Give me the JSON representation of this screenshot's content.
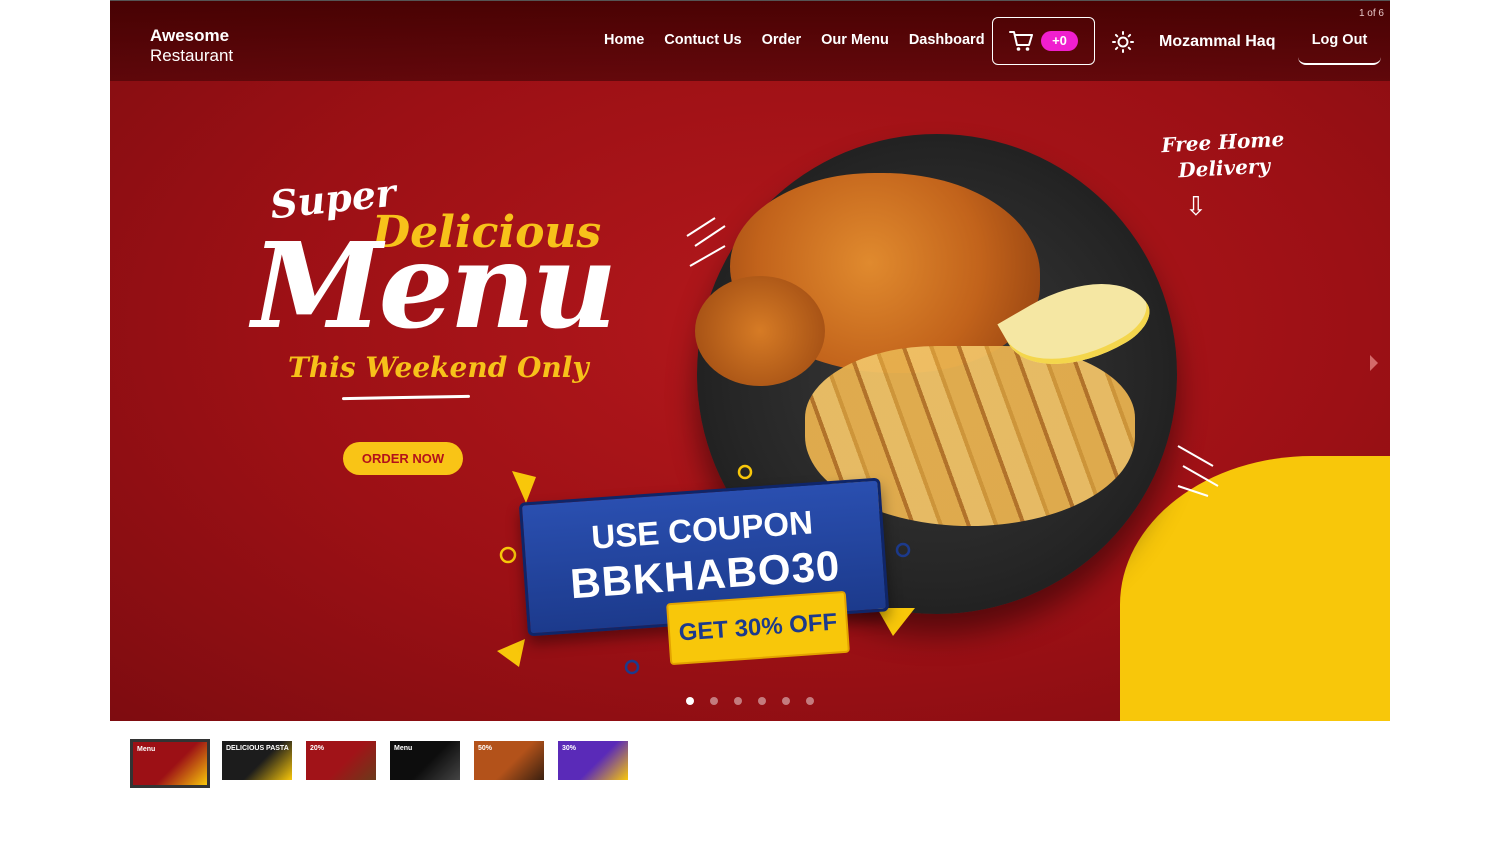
{
  "window": {
    "slide_counter": "1 of 6"
  },
  "navbar": {
    "brand_line1": "Awesome",
    "brand_line2": "Restaurant",
    "links": [
      "Home",
      "Contuct Us",
      "Order",
      "Our Menu",
      "Dashboard"
    ],
    "cart_badge": "+0",
    "user_name": "Mozammal Haq",
    "logout_label": "Log Out"
  },
  "hero": {
    "super": "Super",
    "delicious": "Delicious",
    "menu": "Menu",
    "weekend": "This Weekend Only",
    "cta_label": "ORDER NOW",
    "free_delivery_line1": "Free Home",
    "free_delivery_line2": "Delivery",
    "coupon_line1": "USE COUPON",
    "coupon_code": "BBKHABO30",
    "discount": "GET 30% OFF"
  },
  "carousel": {
    "slide_count": 6,
    "active_index": 0
  },
  "thumbnails": [
    {
      "caption": "Menu",
      "colors": [
        "#9c1015",
        "#f8c70a"
      ]
    },
    {
      "caption": "DELICIOUS PASTA",
      "colors": [
        "#1c1c1c",
        "#f8c70a"
      ]
    },
    {
      "caption": "20%",
      "colors": [
        "#a11318",
        "#6b3a1a"
      ]
    },
    {
      "caption": "Menu",
      "colors": [
        "#0d0d0d",
        "#444444"
      ]
    },
    {
      "caption": "50%",
      "colors": [
        "#b3521a",
        "#3a2010"
      ]
    },
    {
      "caption": "30%",
      "colors": [
        "#5a2ab8",
        "#f8c70a"
      ]
    }
  ],
  "colors": {
    "brand_red": "#a11318",
    "accent_yellow": "#f8c70a",
    "badge_pink": "#f01fcf",
    "coupon_blue": "#1c3a8c"
  }
}
